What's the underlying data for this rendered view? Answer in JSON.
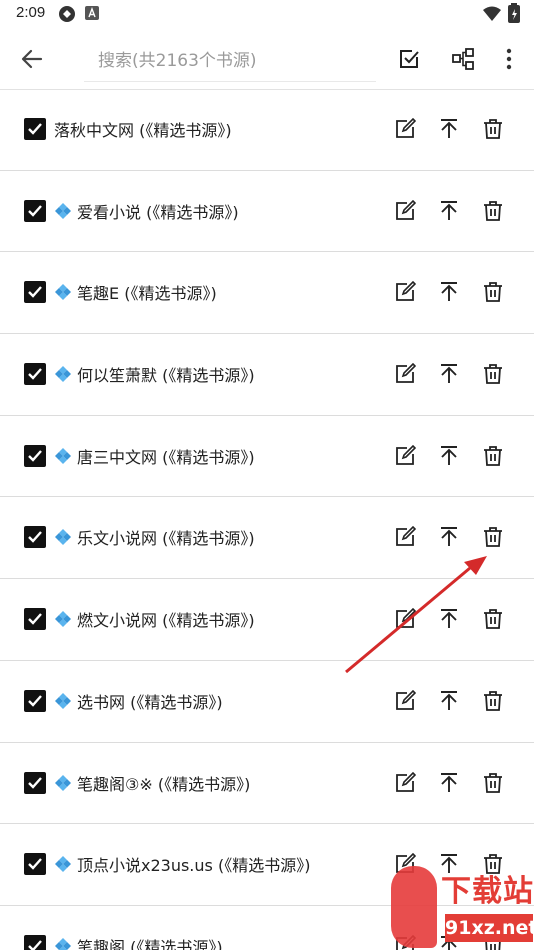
{
  "status_bar": {
    "time": "2:09",
    "icons": [
      "sync-icon",
      "notification-a-icon",
      "wifi-icon",
      "battery-icon"
    ]
  },
  "toolbar": {
    "back_icon": "arrow-left-icon",
    "search_placeholder": "搜索(共2163个书源)",
    "actions": [
      "select-all-icon",
      "group-icon",
      "more-vert-icon"
    ]
  },
  "sources": [
    {
      "name": "落秋中文网 (《精选书源》)",
      "checked": true,
      "has_icon": false
    },
    {
      "name": "爱看小说 (《精选书源》)",
      "checked": true,
      "has_icon": true
    },
    {
      "name": "笔趣E (《精选书源》)",
      "checked": true,
      "has_icon": true
    },
    {
      "name": "何以笙萧默 (《精选书源》)",
      "checked": true,
      "has_icon": true
    },
    {
      "name": "唐三中文网 (《精选书源》)",
      "checked": true,
      "has_icon": true
    },
    {
      "name": "乐文小说网 (《精选书源》)",
      "checked": true,
      "has_icon": true
    },
    {
      "name": "燃文小说网 (《精选书源》)",
      "checked": true,
      "has_icon": true
    },
    {
      "name": " 选书网 (《精选书源》)",
      "checked": true,
      "has_icon": true
    },
    {
      "name": "笔趣阁③※ (《精选书源》)",
      "checked": true,
      "has_icon": true
    },
    {
      "name": "顶点小说x23us.us (《精选书源》)",
      "checked": true,
      "has_icon": true
    },
    {
      "name": "笔趣阁 (《精选书源》)",
      "checked": true,
      "has_icon": true
    }
  ],
  "row_actions": [
    "edit-icon",
    "move-to-top-icon",
    "delete-icon"
  ],
  "colors": {
    "accent": "#111111",
    "annotation_arrow": "#d42a2a",
    "diamond_icon": "#4aa8e8",
    "watermark": "#e33d36"
  },
  "watermark": {
    "title": "下载站",
    "domain": "91xz.net"
  }
}
